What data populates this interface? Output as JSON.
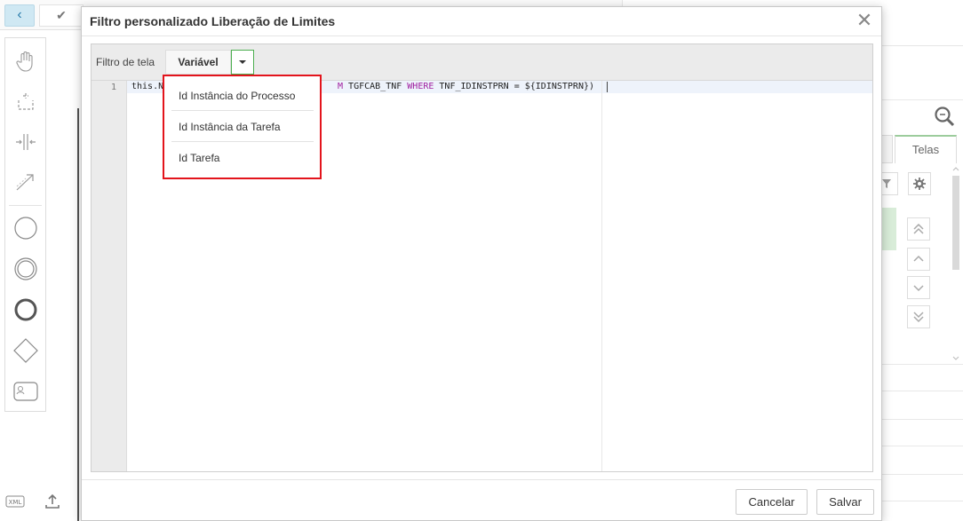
{
  "modal": {
    "title": "Filtro personalizado Liberação de Limites",
    "close_glyph": "✕"
  },
  "filter_bar": {
    "label": "Filtro de tela",
    "variable_button": "Variável"
  },
  "editor": {
    "line_number": "1",
    "code_start": "this.N",
    "code_keyword_from": "M",
    "code_table": " TGFCAB_TNF ",
    "code_keyword_where": "WHERE",
    "code_condition": " TNF_IDINSTPRN = ${IDINSTPRN})"
  },
  "dropdown": {
    "items": [
      {
        "label": "Id Instância do Processo"
      },
      {
        "label": "Id Instância da Tarefa"
      },
      {
        "label": "Id Tarefa"
      }
    ]
  },
  "footer": {
    "cancel": "Cancelar",
    "save": "Salvar"
  },
  "background": {
    "back_glyph": "‹",
    "check_glyph": "✔",
    "right_tab": "Telas",
    "xml_label": "XML"
  },
  "colors": {
    "highlight_border": "#e3141c",
    "caret_border": "#4caf50",
    "keyword": "#a020a0"
  }
}
